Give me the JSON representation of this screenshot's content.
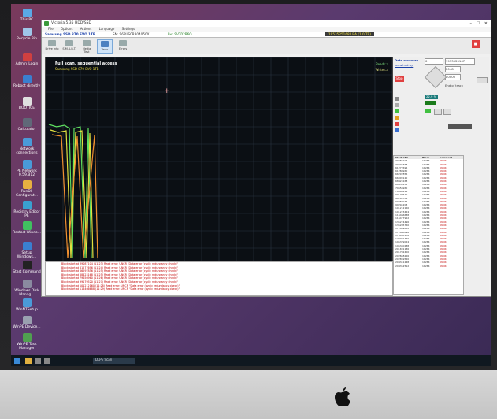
{
  "window": {
    "title": "Victoria 5.35 HDD/SSD",
    "menu": [
      "File",
      "Options",
      "Actions",
      "Language",
      "Settings"
    ],
    "drive_model": "Samsung SSD 870 EVO 1TB",
    "drive_serial": "SN: S6PUS0R804050X",
    "firmware": "Fw: SVT02B6Q",
    "lba_readout": "1953525168 LBA (1.0 TB)"
  },
  "toolbar": {
    "items": [
      "Drive Info",
      "S.M.A.R.T.",
      "Media Test",
      "Tests",
      "Errors"
    ]
  },
  "plot": {
    "title": "Full scan, sequential access",
    "subtitle": "Samsung SSD 870 EVO 1TB",
    "read_label": "Read",
    "write_label": "Write"
  },
  "right_panel": {
    "header": "Data recovery",
    "site": "www.hdd.by",
    "start_lba": "0",
    "end_lba": "1953525167",
    "block": "2048",
    "timeout": "10000",
    "end_of_track": "End of track",
    "speed_readout": "22.9 %",
    "col_start": "Start LBA",
    "col_block": "Block",
    "col_comment": "Comment",
    "rows": [
      [
        "39087104",
        "11264",
        "UNCR"
      ],
      [
        "39098368",
        "11264",
        "UNCR"
      ],
      [
        "61277696",
        "11264",
        "UNCR"
      ],
      [
        "61288960",
        "11264",
        "UNCR"
      ],
      [
        "66297856",
        "11264",
        "UNCR"
      ],
      [
        "66309120",
        "11264",
        "UNCR"
      ],
      [
        "68423168",
        "11264",
        "UNCR"
      ],
      [
        "68434432",
        "11264",
        "UNCR"
      ],
      [
        "79656960",
        "11264",
        "UNCR"
      ],
      [
        "79668224",
        "11264",
        "UNCR"
      ],
      [
        "99179520",
        "11264",
        "UNCR"
      ],
      [
        "99190784",
        "11264",
        "UNCR"
      ],
      [
        "99282944",
        "11264",
        "UNCR"
      ],
      [
        "99294208",
        "11264",
        "UNCR"
      ],
      [
        "101212160",
        "11264",
        "UNCR"
      ],
      [
        "101223424",
        "11264",
        "UNCR"
      ],
      [
        "116466688",
        "11264",
        "UNCR"
      ],
      [
        "116477952",
        "11264",
        "UNCR"
      ],
      [
        "135274496",
        "11264",
        "UNCR"
      ],
      [
        "135285760",
        "11264",
        "UNCR"
      ],
      [
        "172869632",
        "11264",
        "UNCR"
      ],
      [
        "172880896",
        "11264",
        "UNCR"
      ],
      [
        "179890176",
        "11264",
        "UNCR"
      ],
      [
        "179901440",
        "11264",
        "UNCR"
      ],
      [
        "195329024",
        "11264",
        "UNCR"
      ],
      [
        "195340288",
        "11264",
        "UNCR"
      ],
      [
        "201691136",
        "11264",
        "UNCR"
      ],
      [
        "201702400",
        "11264",
        "UNCR"
      ],
      [
        "202848256",
        "11264",
        "UNCR"
      ],
      [
        "202859520",
        "11264",
        "UNCR"
      ],
      [
        "204341248",
        "11264",
        "UNCR"
      ],
      [
        "204352512",
        "11264",
        "UNCR"
      ]
    ]
  },
  "log": {
    "lines": [
      "Block start at 39087104 (11:23) Read error: UNCR \"Data error (cyclic redundancy check)\"",
      "Block start at 61277696 (11:24) Read error: UNCR \"Data error (cyclic redundancy check)\"",
      "Block start at 66297856 (11:25) Read error: UNCR \"Data error (cyclic redundancy check)\"",
      "Block start at 68423168 (11:25) Read error: UNCR \"Data error (cyclic redundancy check)\"",
      "Block start at 79656960 (11:26) Read error: UNCR \"Data error (cyclic redundancy check)\"",
      "Block start at 99179520 (11:27) Read error: UNCR \"Data error (cyclic redundancy check)\"",
      "Block start at 101212160 (11:28) Read error: UNCR \"Data error (cyclic redundancy check)\"",
      "Block start at 116466688 (11:29) Read error: UNCR \"Data error (cyclic redundancy check)\""
    ]
  },
  "desktop": {
    "icons": [
      "This PC",
      "Recycle Bin",
      "Admin_Login",
      "Reboot directly",
      "BOOTICE",
      "Calculator",
      "Network connections",
      "PE Network 0.59.B12",
      "RunDll Configurat...",
      "Registry Editor PE",
      "Restart Windo...",
      "Setup Windows...",
      "Start Command",
      "Windows Disk Manag...",
      "WinNTSetup",
      "WinPE Device...",
      "WinPE Task Manager"
    ]
  },
  "taskbar": {
    "active_app": "DLPE Scan"
  }
}
